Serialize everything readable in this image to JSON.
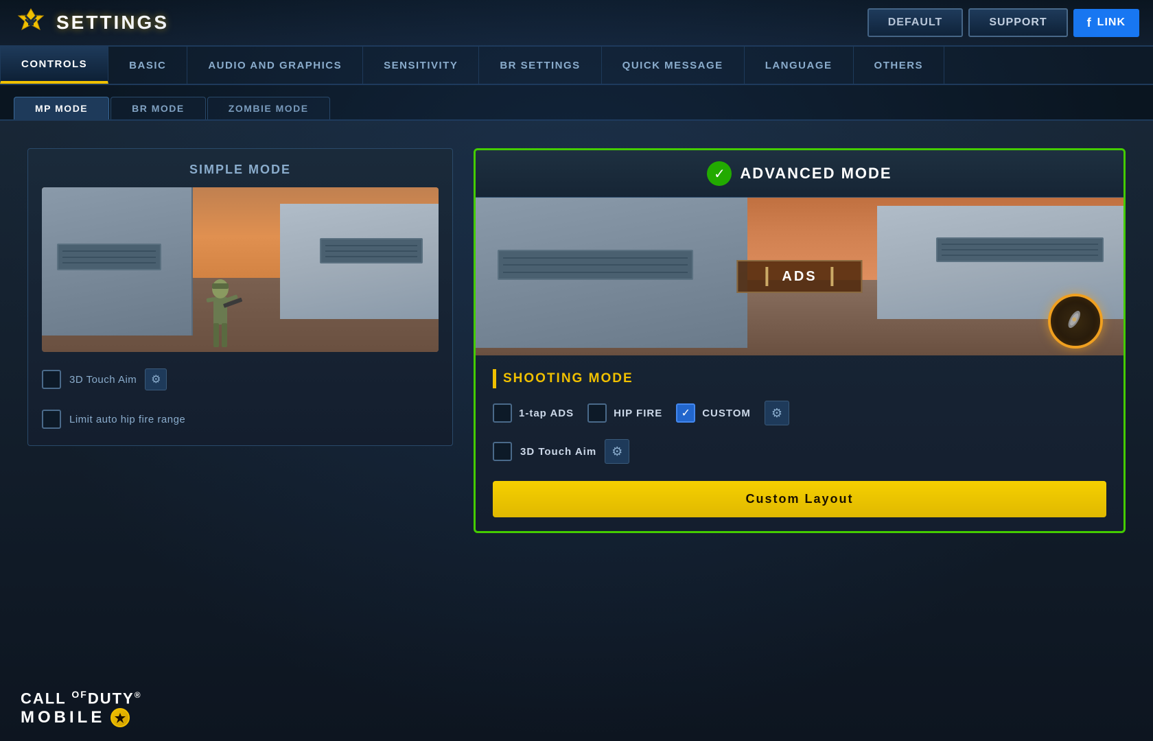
{
  "app": {
    "title": "SETTINGS",
    "logo_alt": "Call of Duty settings logo"
  },
  "topbar": {
    "default_label": "DEFAULT",
    "support_label": "SUPPORT",
    "link_label": "LINK"
  },
  "nav_tabs": [
    {
      "id": "controls",
      "label": "CONTROLS",
      "active": true
    },
    {
      "id": "basic",
      "label": "BASIC",
      "active": false
    },
    {
      "id": "audio-graphics",
      "label": "AUDIO AND GRAPHICS",
      "active": false
    },
    {
      "id": "sensitivity",
      "label": "SENSITIVITY",
      "active": false
    },
    {
      "id": "br-settings",
      "label": "BR SETTINGS",
      "active": false
    },
    {
      "id": "quick-message",
      "label": "QUICK MESSAGE",
      "active": false
    },
    {
      "id": "language",
      "label": "LANGUAGE",
      "active": false
    },
    {
      "id": "others",
      "label": "OTHERS",
      "active": false
    }
  ],
  "sub_tabs": [
    {
      "id": "mp-mode",
      "label": "MP MODE",
      "active": true
    },
    {
      "id": "br-mode",
      "label": "BR MODE",
      "active": false
    },
    {
      "id": "zombie-mode",
      "label": "ZOMBIE MODE",
      "active": false
    }
  ],
  "simple_mode": {
    "title": "SIMPLE MODE",
    "option1_label": "3D Touch Aim",
    "option2_label": "Limit auto hip fire range",
    "option1_checked": false,
    "option2_checked": false
  },
  "advanced_mode": {
    "title": "ADVANCED MODE",
    "active": true,
    "ads_label": "ADS",
    "shooting_mode_title": "SHOOTING MODE",
    "option_1tap_label": "1-tap ADS",
    "option_1tap_checked": false,
    "option_hip_label": "HIP FIRE",
    "option_hip_checked": false,
    "option_custom_label": "CUSTOM",
    "option_custom_checked": true,
    "touch_aim_label": "3D Touch Aim",
    "touch_aim_checked": false,
    "custom_layout_label": "Custom Layout"
  },
  "cod_logo": {
    "line1": "CALLᵇDUTY.",
    "line2": "MOBILE",
    "registered": "®"
  }
}
